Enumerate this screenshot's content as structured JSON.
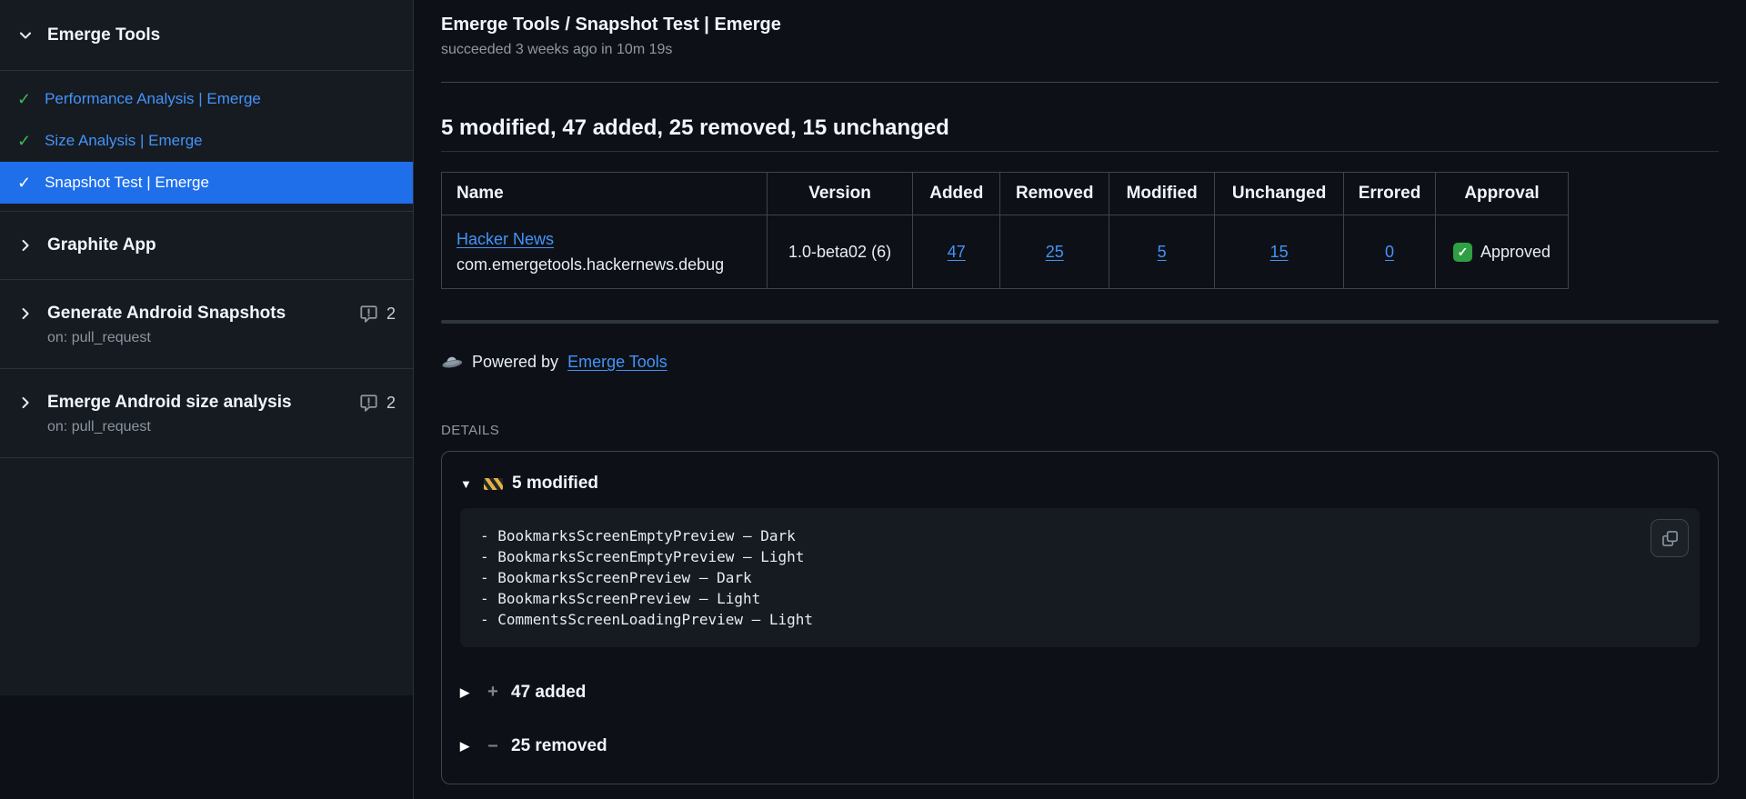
{
  "icons": {
    "check": "✓",
    "triangle_down": "▼",
    "triangle_right": "▶",
    "plus": "+",
    "minus": "–"
  },
  "colors": {
    "selected_accent": "#1f6feb",
    "link_blue": "#4493f8",
    "success_green": "#3fb950",
    "approved_green": "#2ea043"
  },
  "sidebar": {
    "workflow_name": "Emerge Tools",
    "jobs": [
      {
        "label": "Performance Analysis | Emerge",
        "status": "success"
      },
      {
        "label": "Size Analysis | Emerge",
        "status": "success"
      },
      {
        "label": "Snapshot Test | Emerge",
        "status": "success",
        "selected": true
      }
    ],
    "groups": [
      {
        "label": "Graphite App"
      }
    ],
    "workflows": [
      {
        "label": "Generate Android Snapshots",
        "trigger": "on: pull_request",
        "annotation_count": "2"
      },
      {
        "label": "Emerge Android size analysis",
        "trigger": "on: pull_request",
        "annotation_count": "2"
      }
    ]
  },
  "header": {
    "title": "Emerge Tools / Snapshot Test | Emerge",
    "subtitle": "succeeded 3 weeks ago in 10m 19s"
  },
  "summary": {
    "heading": "5 modified, 47 added, 25 removed, 15 unchanged"
  },
  "table": {
    "headers": [
      "Name",
      "Version",
      "Added",
      "Removed",
      "Modified",
      "Unchanged",
      "Errored",
      "Approval"
    ],
    "row": {
      "app_name": "Hacker News",
      "bundle_id": "com.emergetools.hackernews.debug",
      "version": "1.0-beta02 (6)",
      "added": "47",
      "removed": "25",
      "modified": "5",
      "unchanged": "15",
      "errored": "0",
      "approval": "Approved"
    }
  },
  "powered_by": {
    "prefix": "Powered by",
    "link": "Emerge Tools"
  },
  "details": {
    "label": "DETAILS",
    "modified": {
      "title": "5 modified",
      "lines": [
        "- BookmarksScreenEmptyPreview — Dark",
        "- BookmarksScreenEmptyPreview — Light",
        "- BookmarksScreenPreview — Dark",
        "- BookmarksScreenPreview — Light",
        "- CommentsScreenLoadingPreview — Light"
      ]
    },
    "added": {
      "title": "47 added"
    },
    "removed": {
      "title": "25 removed"
    }
  }
}
